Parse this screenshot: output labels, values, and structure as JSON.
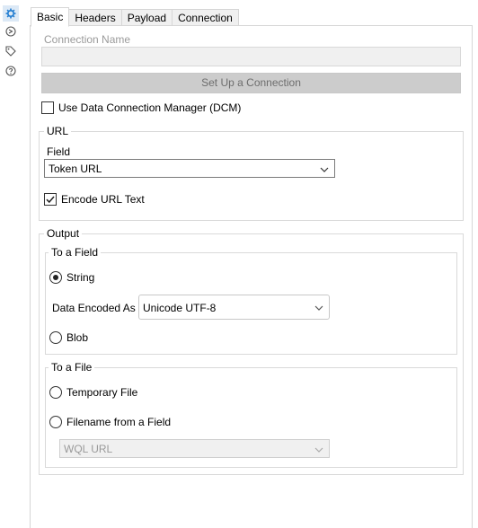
{
  "sidebar": {
    "icons": [
      "gear-icon",
      "connection-icon",
      "tag-icon",
      "help-icon"
    ]
  },
  "tabs": [
    {
      "label": "Basic",
      "active": true
    },
    {
      "label": "Headers",
      "active": false
    },
    {
      "label": "Payload",
      "active": false
    },
    {
      "label": "Connection",
      "active": false
    }
  ],
  "connection": {
    "name_label": "Connection Name",
    "name_value": "",
    "setup_button": "Set Up a Connection",
    "dcm_label": "Use Data Connection Manager (DCM)",
    "dcm_checked": false
  },
  "url": {
    "group_title": "URL",
    "field_label": "Field",
    "field_value": "Token URL",
    "encode_label": "Encode URL Text",
    "encode_checked": true
  },
  "output": {
    "group_title": "Output",
    "to_field": {
      "title": "To a Field",
      "string_label": "String",
      "string_selected": true,
      "encoded_as_label": "Data Encoded As",
      "encoded_as_value": "Unicode UTF-8",
      "blob_label": "Blob",
      "blob_selected": false
    },
    "to_file": {
      "title": "To a File",
      "temp_label": "Temporary File",
      "temp_selected": false,
      "filename_label": "Filename from a Field",
      "filename_selected": false,
      "filename_field_value": "WQL URL"
    }
  },
  "colors": {
    "accent": "#1e7bd0",
    "border": "#d9d9d9",
    "disabled_text": "#9a9a9a"
  }
}
